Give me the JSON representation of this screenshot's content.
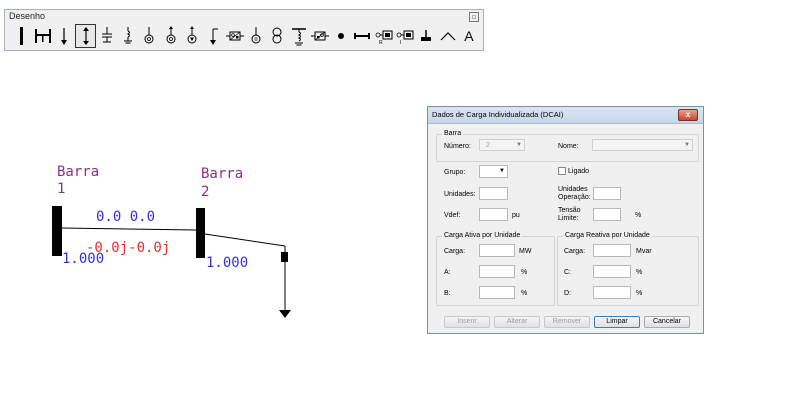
{
  "toolbar": {
    "title": "Desenho",
    "close": "▫",
    "tools": [
      {
        "name": "bus-tool-icon"
      },
      {
        "name": "line-tool-icon"
      },
      {
        "name": "load-tool-icon"
      },
      {
        "name": "connection-tool-icon",
        "selected": true
      },
      {
        "name": "shunt-capacitor-tool-icon"
      },
      {
        "name": "shunt-reactor-tool-icon"
      },
      {
        "name": "generator-tool-icon"
      },
      {
        "name": "synchronous-compensator-tool-icon"
      },
      {
        "name": "static-compensator-tool-icon"
      },
      {
        "name": "individual-load-tool-icon"
      },
      {
        "name": "converter-tool-icon"
      },
      {
        "name": "motor-tool-icon"
      },
      {
        "name": "transformer-tool-icon"
      },
      {
        "name": "three-winding-transformer-tool-icon"
      },
      {
        "name": "series-compensator-tool-icon"
      },
      {
        "name": "node-tool-icon"
      },
      {
        "name": "dc-line-tool-icon"
      },
      {
        "name": "rectifier-tool-icon"
      },
      {
        "name": "inverter-tool-icon"
      },
      {
        "name": "ground-tool-icon"
      },
      {
        "name": "arc-tool-icon"
      },
      {
        "name": "text-tool-icon",
        "letter": "A"
      }
    ]
  },
  "diagram": {
    "bus1": {
      "label": "Barra",
      "number": "1",
      "voltage": "1.000"
    },
    "bus2": {
      "label": "Barra",
      "number": "2",
      "voltage": "1.000"
    },
    "flow_from": "0.0 0.0",
    "flow_to": "-0.0j-0.0j",
    "colors": {
      "bus_name": "#8b2e8b",
      "flow": "#3333cc",
      "negative_flow": "#e03030"
    }
  },
  "dialog": {
    "title": "Dados de Carga Individualizada (DCAI)",
    "close_label": "x",
    "barra": {
      "group_label": "Barra",
      "numero_label": "Número:",
      "numero_value": "2",
      "nome_label": "Nome:",
      "nome_value": ""
    },
    "grupo_label": "Grupo:",
    "grupo_value": "",
    "ligado_label": "Ligado",
    "unidades_label": "Unidades:",
    "unidades_operacao_label_1": "Unidades",
    "unidades_operacao_label_2": "Operação:",
    "vdef_label": "Vdef:",
    "vdef_unit": "pu",
    "tensao_label_1": "Tensão",
    "tensao_label_2": "Limite:",
    "tensao_unit": "%",
    "ativa": {
      "group_label": "Carga Ativa por Unidade",
      "carga_label": "Carga:",
      "carga_unit": "MW",
      "a_label": "A:",
      "a_unit": "%",
      "b_label": "B:",
      "b_unit": "%"
    },
    "reativa": {
      "group_label": "Carga Reativa por Unidade",
      "carga_label": "Carga:",
      "carga_unit": "Mvar",
      "c_label": "C:",
      "c_unit": "%",
      "d_label": "D:",
      "d_unit": "%"
    },
    "buttons": {
      "inserir": "Inserir",
      "alterar": "Alterar",
      "remover": "Remover",
      "limpar": "Limpar",
      "cancelar": "Cancelar"
    }
  }
}
